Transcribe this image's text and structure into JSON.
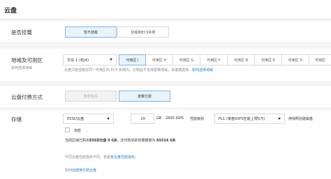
{
  "header": {
    "title": "云盘"
  },
  "attach": {
    "label": "是否挂载",
    "options": [
      "暂不挂载",
      "挂载到ECS实例"
    ]
  },
  "zone": {
    "label": "地域及可用区",
    "sub": "如何选择地域",
    "region_value": "华东 1 (杭州)",
    "zones": [
      "可用区 I",
      "可用区 H",
      "可用区 G",
      "可用区 F",
      "可用区 B",
      "可用区 E",
      "可用区 D",
      "可用区"
    ],
    "note": "云盘只能挂载在同一可用区的 ECS 实例内，订购后不支持更换地域，请谨慎选择。",
    "note_link": "如何选择地域"
  },
  "billing": {
    "label": "云盘付费方式",
    "options": [
      "包年包月",
      "按量付费"
    ]
  },
  "storage": {
    "label": "存储",
    "disk_type": "ESSD云盘",
    "size": "20",
    "unit": "GB",
    "iops": "2800 IOPS",
    "perf_label": "性能级别",
    "perf_value": "PL1 (单盘IOPS性能上限5万)",
    "snapshot_link": "用快照创建磁盘",
    "encrypt_label": "加密",
    "quota_prefix": "当前区域已购买",
    "quota_bold": "ESSD云盘 0 GB",
    "quota_mid": "，还可购买的容量额度为:",
    "quota_value": "65516 GB",
    "perf_note_prefix": "不同云盘性能指标不同，查看",
    "perf_note_link": "各云盘性能指标",
    "perf_note_suffix": "。",
    "howto_prefix": "如何",
    "howto_link": "创建按付费云盘"
  },
  "colors": {
    "accent": "#1a7fd4",
    "selected_bg": "#e9f3fc",
    "selected_border": "#7fb6e6"
  }
}
